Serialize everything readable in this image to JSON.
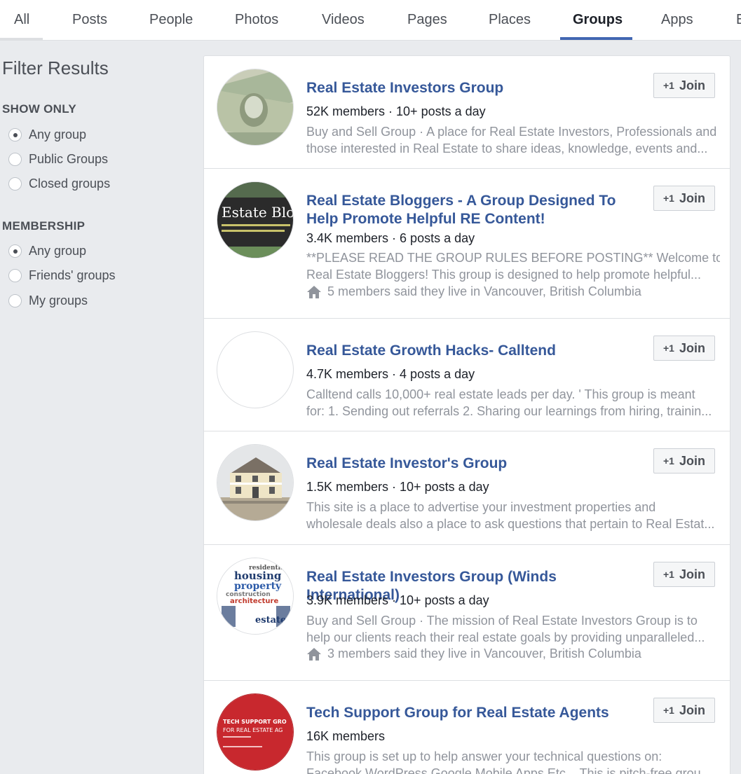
{
  "tabs": [
    {
      "label": "All"
    },
    {
      "label": "Posts"
    },
    {
      "label": "People"
    },
    {
      "label": "Photos"
    },
    {
      "label": "Videos"
    },
    {
      "label": "Pages"
    },
    {
      "label": "Places"
    },
    {
      "label": "Groups"
    },
    {
      "label": "Apps"
    },
    {
      "label": "E"
    }
  ],
  "active_tab": "Groups",
  "accent_color": "#4267b2",
  "link_color": "#365899",
  "sidebar": {
    "title": "Filter Results",
    "show_only": {
      "heading": "SHOW ONLY",
      "options": [
        {
          "label": "Any group",
          "checked": true
        },
        {
          "label": "Public Groups",
          "checked": false
        },
        {
          "label": "Closed groups",
          "checked": false
        }
      ]
    },
    "membership": {
      "heading": "MEMBERSHIP",
      "options": [
        {
          "label": "Any group",
          "checked": true
        },
        {
          "label": "Friends' groups",
          "checked": false
        },
        {
          "label": "My groups",
          "checked": false
        }
      ]
    }
  },
  "join_label": "Join",
  "groups": [
    {
      "title": "Real Estate Investors Group",
      "meta": "52K members · 10+ posts a day",
      "desc": [
        "Buy and Sell Group · A place for Real Estate Investors, Professionals and",
        "those interested in Real Estate to share ideas, knowledge, events and..."
      ],
      "avatar": "dollar-bills-icon"
    },
    {
      "title": "Real Estate Bloggers - A Group Designed To Help Promote Helpful RE Content!",
      "meta": "3.4K members · 6 posts a day",
      "desc": [
        "**PLEASE READ THE GROUP RULES BEFORE POSTING** Welcome to",
        "Real Estate Bloggers! This group is designed to help promote helpful..."
      ],
      "extra": "5 members said they live in Vancouver, British Columbia",
      "avatar": "blog-sign-icon",
      "avatar_text": "Estate Blog"
    },
    {
      "title": "Real Estate Growth Hacks- Calltend",
      "meta": "4.7K members · 4 posts a day",
      "desc": [
        "Calltend calls 10,000+ real estate leads per day. ' This group is meant",
        "for: 1. Sending out referrals 2. Sharing our learnings from hiring, trainin..."
      ],
      "avatar": "blank-avatar-icon"
    },
    {
      "title": "Real Estate Investor's Group",
      "meta": "1.5K members · 10+ posts a day",
      "desc": [
        "This site is a place to advertise your investment properties and",
        "wholesale deals also a place to ask questions that pertain to Real Estat..."
      ],
      "avatar": "house-photo-icon"
    },
    {
      "title": "Real Estate Investors Group (Winds International)",
      "meta": "3.9K members · 10+ posts a day",
      "desc": [
        "Buy and Sell Group · The mission of Real Estate Investors Group is to",
        "help our clients reach their real estate goals by providing unparalleled..."
      ],
      "extra": "3 members said they live in Vancouver, British Columbia",
      "avatar": "word-cloud-house-icon",
      "avatar_words": [
        "residential",
        "housing",
        "property",
        "construction",
        "architecture",
        "estate"
      ]
    },
    {
      "title": "Tech Support Group for Real Estate Agents",
      "meta": "16K members",
      "desc": [
        "This group is set up to help answer your technical questions on:",
        "Facebook WordPress Google Mobile Apps Etc... This is pitch-free grou..."
      ],
      "avatar": "tech-support-badge-icon",
      "avatar_text": [
        "TECH SUPPORT GRO",
        "FOR REAL ESTATE AG"
      ]
    }
  ]
}
